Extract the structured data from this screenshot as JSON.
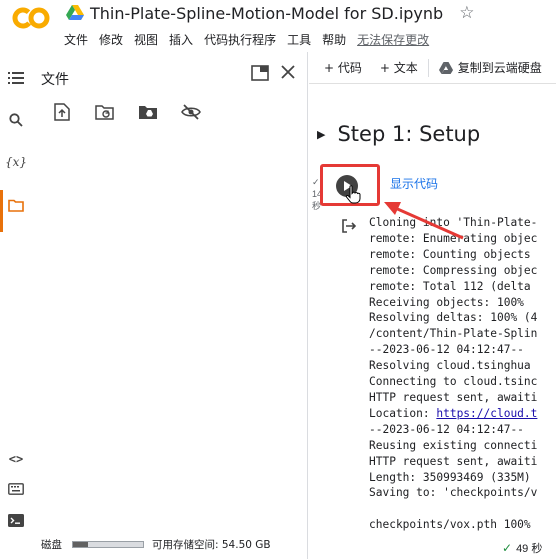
{
  "header": {
    "title": "Thin-Plate-Spline-Motion-Model for SD.ipynb",
    "logo_text": "CO",
    "menu": [
      "文件",
      "修改",
      "视图",
      "插入",
      "代码执行程序",
      "工具",
      "帮助"
    ],
    "unsaved": "无法保存更改"
  },
  "sidebar": {
    "icons": [
      "toc-icon",
      "search-icon",
      "variables-icon",
      "folder-icon",
      "code-snippets-icon",
      "command-palette-icon",
      "terminal-icon"
    ],
    "variables_glyph": "{x}",
    "code_glyph": "<>"
  },
  "files": {
    "title": "文件",
    "disk_label": "磁盘",
    "disk_used_fraction": 0.22,
    "disk_free": "可用存储空间: 54.50 GB"
  },
  "toolbar": {
    "add_code": "+ 代码",
    "add_text": "+ 文本",
    "copy_drive": "复制到云端硬盘"
  },
  "notebook": {
    "section_title": "Step 1: Setup",
    "show_code": "显示代码",
    "exec_lines": [
      "✓",
      "14",
      "秒"
    ],
    "output_lines": [
      "Cloning into 'Thin-Plate-",
      "remote: Enumerating objec",
      "remote: Counting objects",
      "remote: Compressing objec",
      "remote: Total 112 (delta",
      "Receiving objects: 100%",
      "Resolving deltas: 100% (4",
      "/content/Thin-Plate-Splin",
      "--2023-06-12 04:12:47--",
      "Resolving cloud.tsinghua",
      "Connecting to cloud.tsinc",
      "HTTP request sent, awaiti",
      "Location: ",
      "--2023-06-12 04:12:47--",
      "Reusing existing connecti",
      "HTTP request sent, awaiti",
      "Length: 350993469 (335M)",
      "Saving to: 'checkpoints/v",
      "",
      "checkpoints/vox.pth 100%"
    ],
    "location_link": "https://cloud.t"
  },
  "status": {
    "check": "✓",
    "time": "49 秒"
  },
  "colors": {
    "accent": "#e8710a",
    "highlight": "#e53935",
    "link": "#1a73e8"
  }
}
